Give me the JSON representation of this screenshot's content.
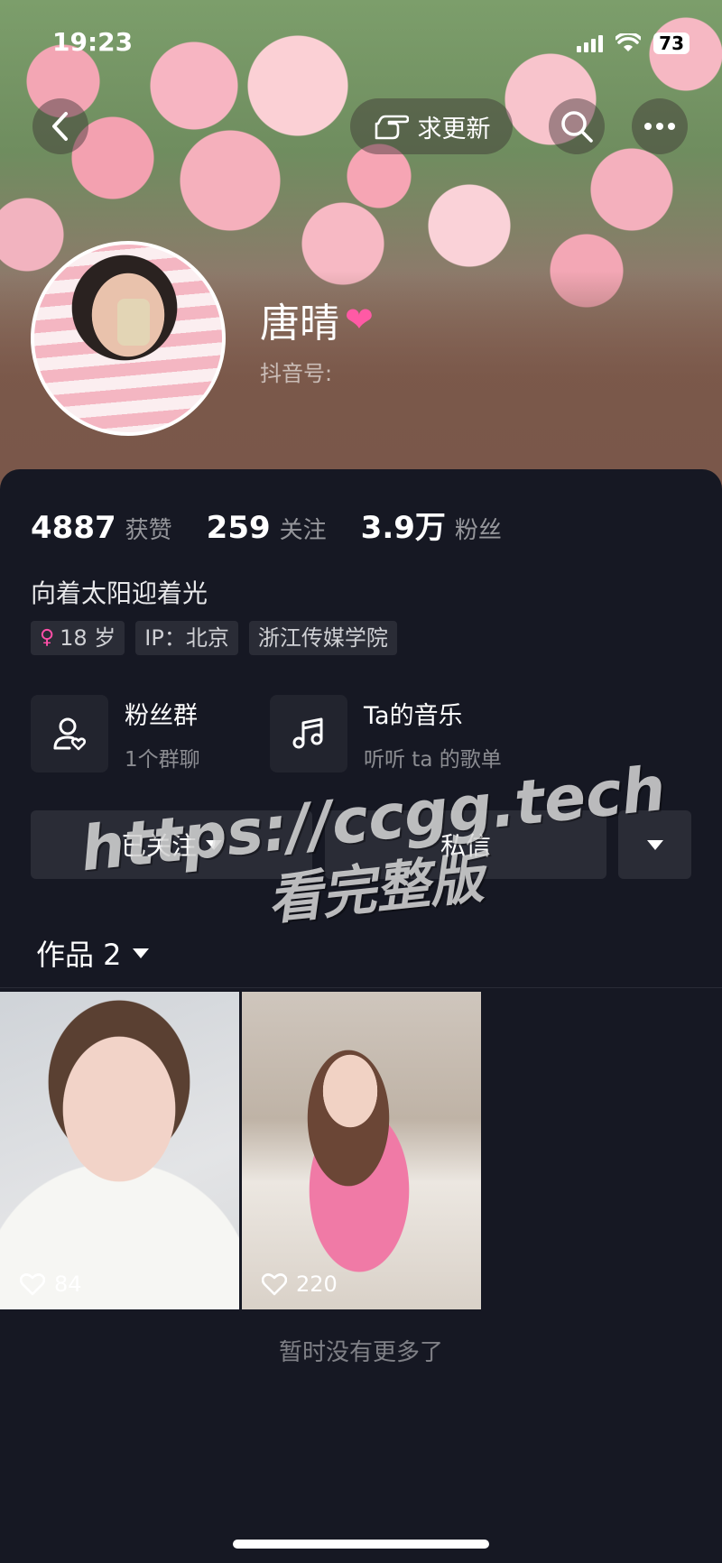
{
  "status_bar": {
    "time": "19:23",
    "battery": "73"
  },
  "nav": {
    "request_update_label": "求更新"
  },
  "profile": {
    "name": "唐晴",
    "douyin_id_label": "抖音号:",
    "stats": [
      {
        "value": "4887",
        "label": "获赞"
      },
      {
        "value": "259",
        "label": "关注"
      },
      {
        "value": "3.9万",
        "label": "粉丝"
      }
    ],
    "bio": "向着太阳迎着光",
    "tags": {
      "age": "18 岁",
      "ip": "IP：北京",
      "school": "浙江传媒学院"
    }
  },
  "cards": {
    "fan_group": {
      "title": "粉丝群",
      "sub": "1个群聊"
    },
    "music": {
      "title": "Ta的音乐",
      "sub": "听听 ta 的歌单"
    }
  },
  "actions": {
    "followed_label": "已关注",
    "message_label": "私信"
  },
  "works": {
    "tab_label": "作品 2",
    "items": [
      {
        "likes": "84"
      },
      {
        "likes": "220"
      }
    ],
    "end_text": "暂时没有更多了"
  },
  "watermark": {
    "line1": "https://ccgg.tech",
    "line2": "看完整版"
  },
  "icons": [
    "back-icon",
    "pointing-hand-icon",
    "search-icon",
    "more-icon",
    "user-heart-icon",
    "music-note-icon",
    "heart-icon",
    "female-icon"
  ],
  "colors": {
    "background": "#161823",
    "card": "#2a2c36",
    "accent_female": "#ff4fa8"
  }
}
